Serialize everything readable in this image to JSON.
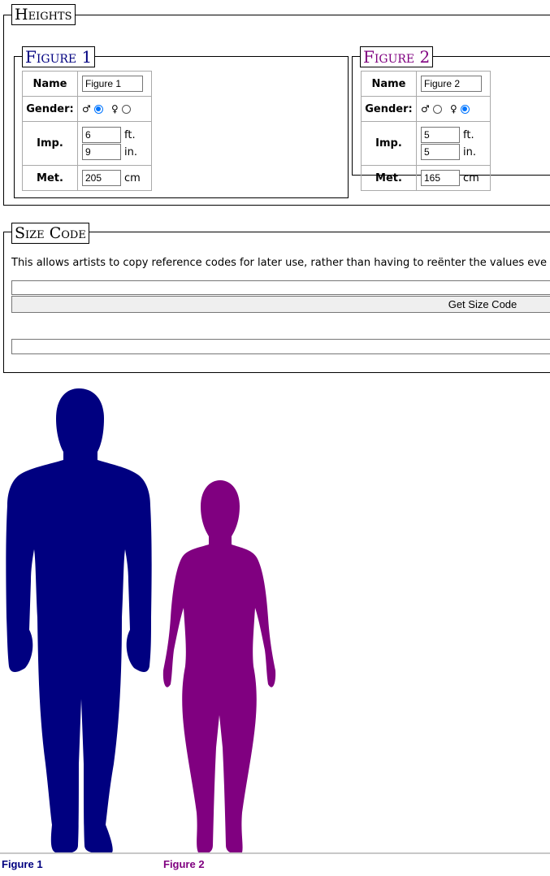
{
  "heights": {
    "legend": "Heights"
  },
  "figures": [
    {
      "legend": "Figure 1",
      "color": "#000080",
      "labels": {
        "name": "Name",
        "gender": "Gender:",
        "imp": "Imp.",
        "met": "Met."
      },
      "name_value": "Figure 1",
      "gender_selected": "male",
      "feet": "6",
      "inches": "9",
      "cm": "205",
      "units": {
        "ft": "ft.",
        "in": "in.",
        "cm": "cm"
      },
      "label": "Figure 1"
    },
    {
      "legend": "Figure 2",
      "color": "#800080",
      "labels": {
        "name": "Name",
        "gender": "Gender:",
        "imp": "Imp.",
        "met": "Met."
      },
      "name_value": "Figure 2",
      "gender_selected": "female",
      "feet": "5",
      "inches": "5",
      "cm": "165",
      "units": {
        "ft": "ft.",
        "in": "in.",
        "cm": "cm"
      },
      "label": "Figure 2"
    }
  ],
  "gender_symbols": {
    "male": "♂",
    "female": "♀"
  },
  "size_code": {
    "legend": "Size Code",
    "description": "This allows artists to copy reference codes for later use, rather than having to reënter the values eve",
    "input_value": "",
    "button_label": "Get Size Code",
    "output_value": ""
  }
}
